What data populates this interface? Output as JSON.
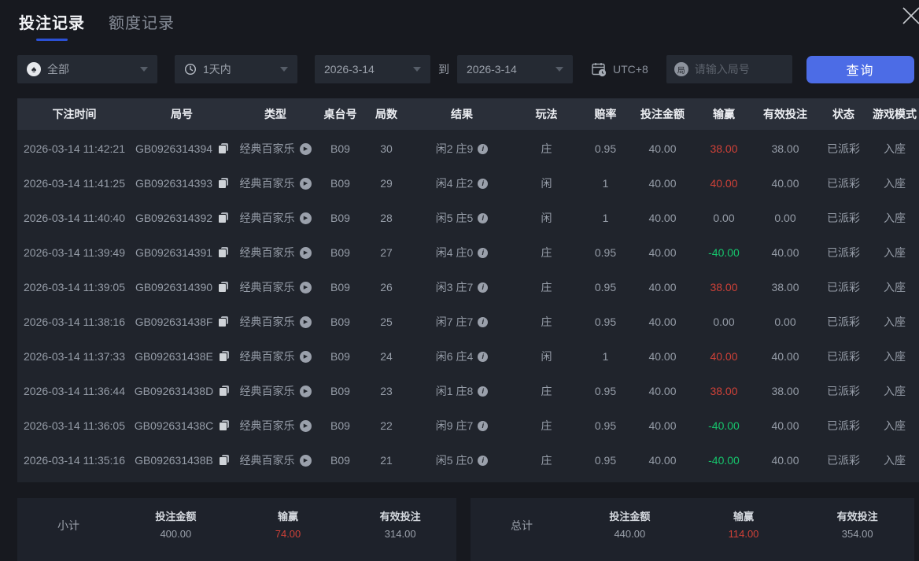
{
  "page": {
    "tabs": [
      {
        "label": "投注记录",
        "active": true
      },
      {
        "label": "额度记录",
        "active": false
      }
    ]
  },
  "filters": {
    "game_type": "全部",
    "time_range": "1天内",
    "date_from": "2026-3-14",
    "to_label": "到",
    "date_to": "2026-3-14",
    "timezone": "UTC+8",
    "round_input_placeholder": "请输入局号",
    "query_button": "查询"
  },
  "table": {
    "columns": [
      "下注时间",
      "局号",
      "类型",
      "桌台号",
      "局数",
      "结果",
      "玩法",
      "赔率",
      "投注金额",
      "输赢",
      "有效投注",
      "状态",
      "游戏模式"
    ],
    "rows": [
      {
        "time": "2026-03-14 11:42:21",
        "round_no": "GB0926314394",
        "type": "经典百家乐",
        "table_no": "B09",
        "round_count": "30",
        "result": "闲2 庄9",
        "play": "庄",
        "odds": "0.95",
        "bet": "40.00",
        "win_loss": "38.00",
        "valid_bet": "38.00",
        "status": "已派彩",
        "mode": "入座"
      },
      {
        "time": "2026-03-14 11:41:25",
        "round_no": "GB0926314393",
        "type": "经典百家乐",
        "table_no": "B09",
        "round_count": "29",
        "result": "闲4 庄2",
        "play": "闲",
        "odds": "1",
        "bet": "40.00",
        "win_loss": "40.00",
        "valid_bet": "40.00",
        "status": "已派彩",
        "mode": "入座"
      },
      {
        "time": "2026-03-14 11:40:40",
        "round_no": "GB0926314392",
        "type": "经典百家乐",
        "table_no": "B09",
        "round_count": "28",
        "result": "闲5 庄5",
        "play": "闲",
        "odds": "1",
        "bet": "40.00",
        "win_loss": "0.00",
        "valid_bet": "0.00",
        "status": "已派彩",
        "mode": "入座"
      },
      {
        "time": "2026-03-14 11:39:49",
        "round_no": "GB0926314391",
        "type": "经典百家乐",
        "table_no": "B09",
        "round_count": "27",
        "result": "闲4 庄0",
        "play": "庄",
        "odds": "0.95",
        "bet": "40.00",
        "win_loss": "-40.00",
        "valid_bet": "40.00",
        "status": "已派彩",
        "mode": "入座"
      },
      {
        "time": "2026-03-14 11:39:05",
        "round_no": "GB0926314390",
        "type": "经典百家乐",
        "table_no": "B09",
        "round_count": "26",
        "result": "闲3 庄7",
        "play": "庄",
        "odds": "0.95",
        "bet": "40.00",
        "win_loss": "38.00",
        "valid_bet": "38.00",
        "status": "已派彩",
        "mode": "入座"
      },
      {
        "time": "2026-03-14 11:38:16",
        "round_no": "GB092631438F",
        "type": "经典百家乐",
        "table_no": "B09",
        "round_count": "25",
        "result": "闲7 庄7",
        "play": "庄",
        "odds": "0.95",
        "bet": "40.00",
        "win_loss": "0.00",
        "valid_bet": "0.00",
        "status": "已派彩",
        "mode": "入座"
      },
      {
        "time": "2026-03-14 11:37:33",
        "round_no": "GB092631438E",
        "type": "经典百家乐",
        "table_no": "B09",
        "round_count": "24",
        "result": "闲6 庄4",
        "play": "闲",
        "odds": "1",
        "bet": "40.00",
        "win_loss": "40.00",
        "valid_bet": "40.00",
        "status": "已派彩",
        "mode": "入座"
      },
      {
        "time": "2026-03-14 11:36:44",
        "round_no": "GB092631438D",
        "type": "经典百家乐",
        "table_no": "B09",
        "round_count": "23",
        "result": "闲1 庄8",
        "play": "庄",
        "odds": "0.95",
        "bet": "40.00",
        "win_loss": "38.00",
        "valid_bet": "38.00",
        "status": "已派彩",
        "mode": "入座"
      },
      {
        "time": "2026-03-14 11:36:05",
        "round_no": "GB092631438C",
        "type": "经典百家乐",
        "table_no": "B09",
        "round_count": "22",
        "result": "闲9 庄7",
        "play": "庄",
        "odds": "0.95",
        "bet": "40.00",
        "win_loss": "-40.00",
        "valid_bet": "40.00",
        "status": "已派彩",
        "mode": "入座"
      },
      {
        "time": "2026-03-14 11:35:16",
        "round_no": "GB092631438B",
        "type": "经典百家乐",
        "table_no": "B09",
        "round_count": "21",
        "result": "闲5 庄0",
        "play": "庄",
        "odds": "0.95",
        "bet": "40.00",
        "win_loss": "-40.00",
        "valid_bet": "40.00",
        "status": "已派彩",
        "mode": "入座"
      }
    ]
  },
  "summary": {
    "subtotal": {
      "label": "小计",
      "bet_label": "投注金额",
      "bet": "400.00",
      "win_label": "输赢",
      "win": "74.00",
      "valid_label": "有效投注",
      "valid": "314.00"
    },
    "total": {
      "label": "总计",
      "bet_label": "投注金额",
      "bet": "440.00",
      "win_label": "输赢",
      "win": "114.00",
      "valid_label": "有效投注",
      "valid": "354.00"
    }
  },
  "colors": {
    "accent_blue": "#4c6ce6",
    "win_red": "#cf4138",
    "loss_green": "#16c46c",
    "tab_underline": "#2b50d4"
  }
}
